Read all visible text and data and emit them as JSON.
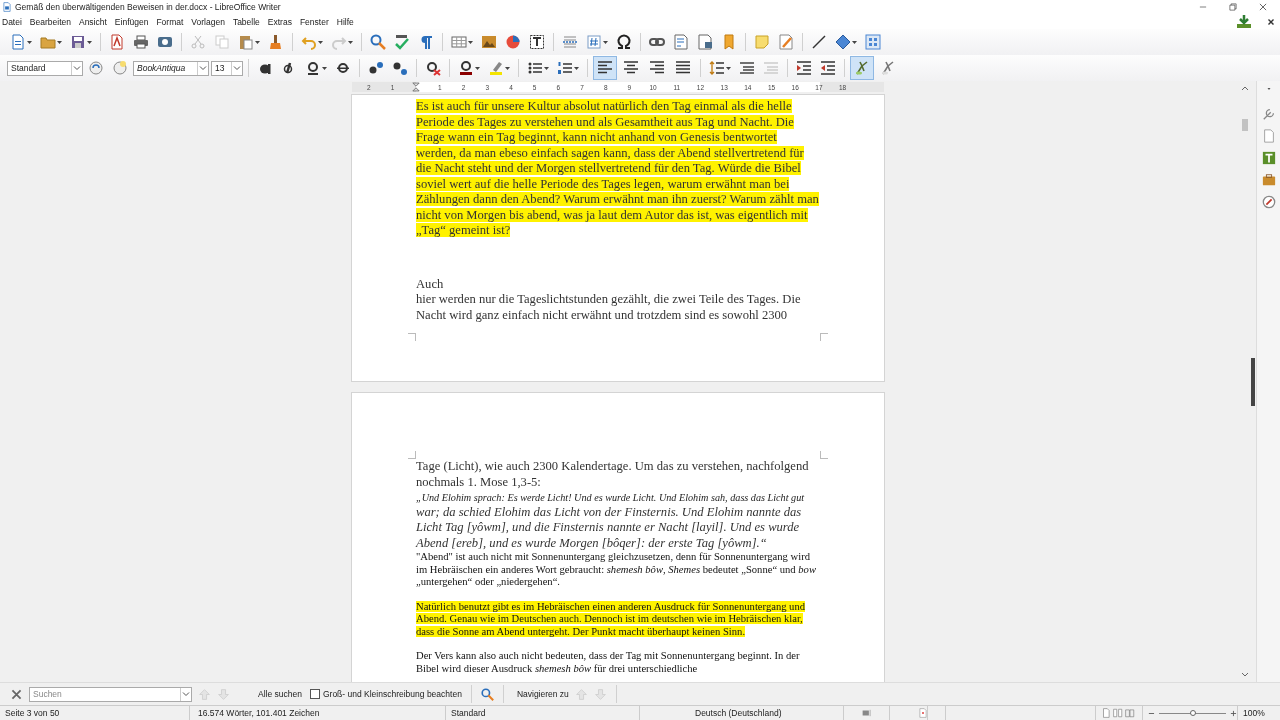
{
  "window": {
    "title": "Gemäß den überwältigenden Beweisen in der.docx - LibreOffice Writer"
  },
  "menu": [
    "Datei",
    "Bearbeiten",
    "Ansicht",
    "Einfügen",
    "Format",
    "Vorlagen",
    "Tabelle",
    "Extras",
    "Fenster",
    "Hilfe"
  ],
  "formatting_toolbar": {
    "paragraph_style": "Standard",
    "font_name": "BookAntiqua",
    "font_size": "13",
    "alignment": [
      {
        "selected": true
      },
      {
        "selected": false
      },
      {
        "selected": false
      },
      {
        "selected": false
      }
    ],
    "pen_buttons": [
      {
        "on": true
      },
      {
        "on": false
      }
    ]
  },
  "ruler": {
    "labels": [
      "2",
      "1",
      "1",
      "2",
      "3",
      "4",
      "5",
      "6",
      "7",
      "8",
      "9",
      "10",
      "11",
      "12",
      "13",
      "14",
      "15",
      "16",
      "17",
      "18"
    ]
  },
  "pages": [
    {
      "paragraphs": [
        {
          "kind": "body",
          "highlighted": true,
          "text": "Es ist auch für unsere Kultur absolut natürlich den Tag einmal als die helle Periode des Tages zu verstehen und als Gesamtheit aus Tag und Nacht. Die Frage wann ein Tag beginnt, kann nicht anhand von Genesis bentwortet werden, da man ebeso einfach sagen kann, dass der Abend stellvertretend für die Nacht steht und der Morgen stellvertretend für den Tag. Würde die Bibel soviel wert auf die helle Periode des Tages legen, warum erwähnt man bei Zählungen dann den Abend? Warum erwähnt man ihn zuerst? Warum zählt man nicht von Morgen bis abend, was ja laut dem Autor das ist, was eigentlich mit „Tag“ gemeint ist?"
        },
        {
          "kind": "body",
          "highlighted": false,
          "text": "Auch\nhier werden nur die Tageslichtstunden gezählt, die zwei Teile des Tages. Die Nacht wird ganz einfach nicht erwähnt und trotzdem sind es sowohl 2300"
        }
      ]
    },
    {
      "paragraphs": [
        {
          "kind": "body",
          "highlighted": false,
          "text": "Tage (Licht), wie auch 2300 Kalendertage. Um das zu verstehen, nachfolgend nochmals 1. Mose 1,3-5:"
        },
        {
          "kind": "quote_small",
          "highlighted": false,
          "text": "„Und Elohim sprach: Es werde Licht! Und es wurde Licht. Und Elohim sah, dass das Licht gut"
        },
        {
          "kind": "quote",
          "highlighted": false,
          "text": "war; da schied Elohim das Licht von der Finsternis. Und Elohim nannte das Licht Tag [yôwm], und die Finsternis nannte er Nacht [layil]. Und es wurde Abend [ereb], und es wurde Morgen [bôqer]: der erste Tag [yôwm].“"
        },
        {
          "kind": "plain",
          "highlighted": false,
          "text": "\"Abend\" ist auch nicht mit Sonnenuntergang gleichzusetzen, denn für Sonnenuntergang wird im Hebräischen ein anderes Wort gebraucht: *shemesh bôw*, *Shemes* bedeutet „Sonne“ und *bow* „untergehen“ oder „niedergehen“."
        },
        {
          "kind": "plain",
          "highlighted": true,
          "text": "Natürlich benutzt gibt es im Hebräischen einen anderen Ausdruck für Sonnenuntergang und Abend. Genau wie im Deutschen auch. Dennoch ist im deutschen wie im Hebräischen klar, dass die Sonne am Abend untergeht. Der Punkt macht überhaupt keinen Sinn."
        },
        {
          "kind": "plain",
          "highlighted": false,
          "text": "Der Vers kann also auch nicht bedeuten, dass der Tag mit Sonnenuntergang beginnt. In der Bibel wird dieser Ausdruck *shemesh bôw* für drei unterschiedliche"
        }
      ]
    }
  ],
  "find_toolbar": {
    "search": {
      "placeholder": "Suchen"
    },
    "find_all": "Alle suchen",
    "match_case": {
      "label": "Groß- und Kleinschreibung beachten",
      "checked": false
    },
    "navigate": "Navigieren zu"
  },
  "status_bar": {
    "page": "Seite 3 von 50",
    "word_count": "16.574 Wörter, 101.401 Zeichen",
    "page_style": "Standard",
    "language": "Deutsch (Deutschland)",
    "zoom": {
      "level": 0.5,
      "label": "100%"
    }
  }
}
